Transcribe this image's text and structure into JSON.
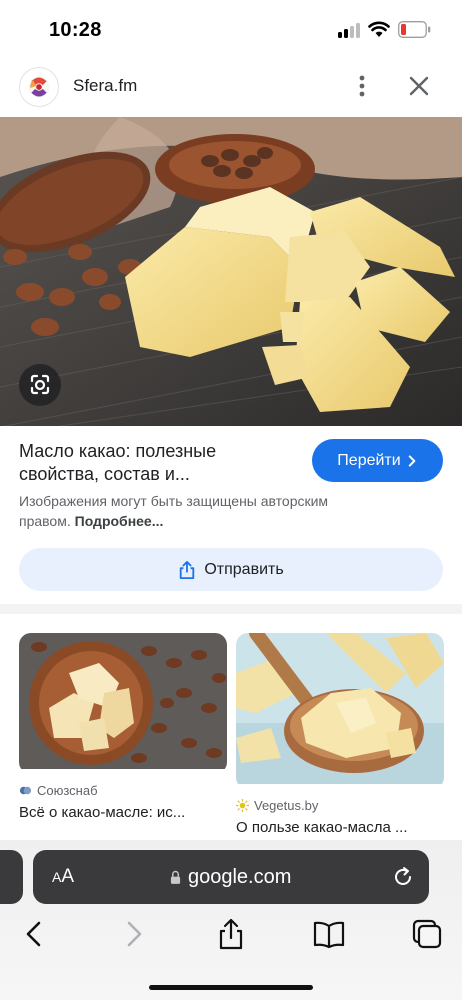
{
  "status_bar": {
    "time": "10:28"
  },
  "source": {
    "site_name": "Sfera.fm"
  },
  "result": {
    "title": "Масло какао: полезные свойства, состав и...",
    "visit_label": "Перейти",
    "copyright_text": "Изображения могут быть защищены авторским правом.",
    "copyright_link": "Подробнее...",
    "share_label": "Отправить"
  },
  "related": [
    {
      "source": "Союзснаб",
      "title": "Всё о какао-масле: ис..."
    },
    {
      "source": "Vegetus.by",
      "title": "О пользе какао-масла ..."
    }
  ],
  "browser": {
    "aa_label_small": "A",
    "aa_label_big": "A",
    "url": "google.com"
  },
  "colors": {
    "accent": "#1a73e8",
    "share_bg": "#e8f0fe",
    "battery_low": "#e53935"
  },
  "icons": [
    "signal-icon",
    "wifi-icon",
    "battery-icon",
    "more-vert-icon",
    "close-icon",
    "lens-icon",
    "chevron-right-icon",
    "share-icon",
    "lock-icon",
    "reload-icon",
    "back-icon",
    "forward-icon",
    "bookmarks-icon",
    "tabs-icon"
  ]
}
